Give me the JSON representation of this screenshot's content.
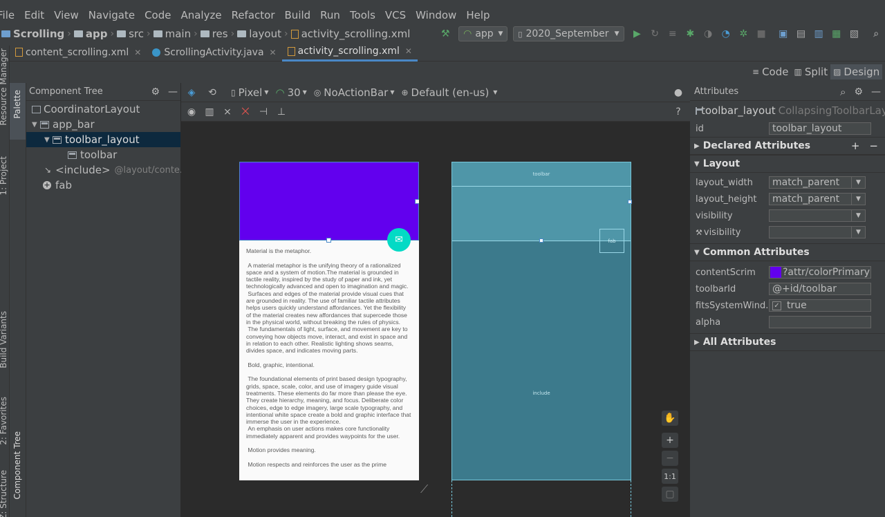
{
  "menu": [
    "File",
    "Edit",
    "View",
    "Navigate",
    "Code",
    "Analyze",
    "Refactor",
    "Build",
    "Run",
    "Tools",
    "VCS",
    "Window",
    "Help"
  ],
  "breadcrumb": [
    "Scrolling",
    "app",
    "src",
    "main",
    "res",
    "layout",
    "activity_scrolling.xml"
  ],
  "toolbar": {
    "config": "app",
    "device": "2020_September"
  },
  "tabs": [
    {
      "label": "content_scrolling.xml",
      "active": false
    },
    {
      "label": "ScrollingActivity.java",
      "active": false
    },
    {
      "label": "activity_scrolling.xml",
      "active": true
    }
  ],
  "view_modes": [
    "Code",
    "Split",
    "Design"
  ],
  "left_tool_windows": [
    "Resource Manager",
    "1: Project",
    "Build Variants",
    "2: Favorites",
    "Z: Structure"
  ],
  "palette_strip": {
    "palette": "Palette",
    "component_tree": "Component Tree"
  },
  "component_tree": {
    "title": "Component Tree",
    "nodes": [
      {
        "label": "CoordinatorLayout",
        "detail": ""
      },
      {
        "label": "app_bar",
        "detail": ""
      },
      {
        "label": "toolbar_layout",
        "detail": "",
        "selected": true
      },
      {
        "label": "toolbar",
        "detail": ""
      },
      {
        "label": "<include>",
        "detail": "@layout/conte..."
      },
      {
        "label": "fab",
        "detail": ""
      }
    ]
  },
  "design_toolbar": {
    "device": "Pixel",
    "api": "30",
    "theme": "NoActionBar",
    "locale": "Default (en-us)"
  },
  "preview_text": "Material is the metaphor.\n\n A material metaphor is the unifying theory of a rationalized space and a system of motion.The material is grounded in tactile reality, inspired by the study of paper and ink, yet technologically advanced and open to imagination and magic.\n Surfaces and edges of the material provide visual cues that are grounded in reality. The use of familiar tactile attributes helps users quickly understand affordances. Yet the flexibility of the material creates new affordances that supercede those in the physical world, without breaking the rules of physics.\n The fundamentals of light, surface, and movement are key to conveying how objects move, interact, and exist in space and in relation to each other. Realistic lighting shows seams, divides space, and indicates moving parts.\n\n Bold, graphic, intentional.\n\n The foundational elements of print based design typography, grids, space, scale, color, and use of imagery guide visual treatments. These elements do far more than please the eye. They create hierarchy, meaning, and focus. Deliberate color choices, edge to edge imagery, large scale typography, and intentional white space create a bold and graphic interface that immerse the user in the experience.\n An emphasis on user actions makes core functionality immediately apparent and provides waypoints for the user.\n\n Motion provides meaning.\n\n Motion respects and reinforces the user as the prime",
  "blueprint": {
    "toolbar": "toolbar",
    "fab": "fab",
    "include": "include"
  },
  "zoom": {
    "fit": "1:1"
  },
  "attributes": {
    "title": "Attributes",
    "component_id": "toolbar_layout",
    "component_class": "CollapsingToolbarLayout",
    "id_label": "id",
    "id_value": "toolbar_layout",
    "declared": "Declared Attributes",
    "layout_section": "Layout",
    "layout": [
      {
        "name": "layout_width",
        "value": "match_parent"
      },
      {
        "name": "layout_height",
        "value": "match_parent"
      },
      {
        "name": "visibility",
        "value": ""
      },
      {
        "name": "visibility",
        "value": ""
      }
    ],
    "common_section": "Common Attributes",
    "common": [
      {
        "name": "contentScrim",
        "value": "?attr/colorPrimary"
      },
      {
        "name": "toolbarId",
        "value": "@+id/toolbar"
      },
      {
        "name": "fitsSystemWind...",
        "value": "true"
      },
      {
        "name": "alpha",
        "value": ""
      }
    ],
    "all": "All Attributes"
  },
  "colors": {
    "primary": "#6200ee",
    "fab": "#03dac5",
    "selection": "#0d293e",
    "blueprint": "#3c7a8c"
  }
}
